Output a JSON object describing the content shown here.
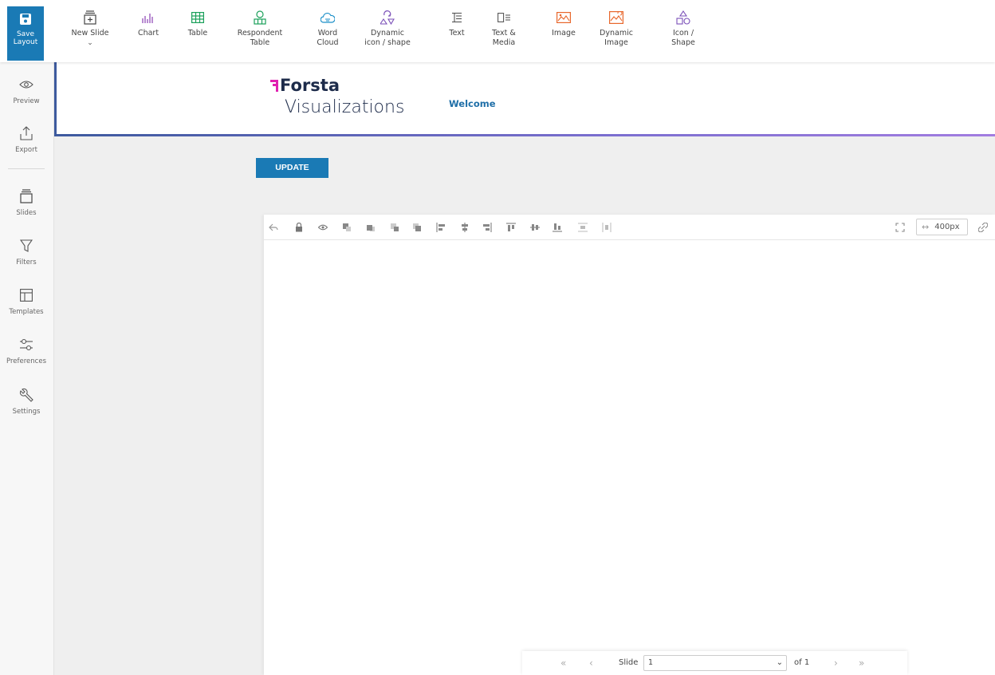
{
  "toolbar": {
    "save": {
      "line1": "Save",
      "line2": "Layout"
    },
    "items": [
      {
        "line1": "New Slide",
        "line2": "",
        "icon": "new-slide-icon",
        "color": "#444444"
      },
      {
        "line1": "Chart",
        "line2": "",
        "icon": "bar-chart-icon",
        "color": "#8a3fb3"
      },
      {
        "line1": "Table",
        "line2": "",
        "icon": "table-icon",
        "color": "#1aa05a"
      },
      {
        "line1": "Respondent",
        "line2": "Table",
        "icon": "respondent-table-icon",
        "color": "#1aa05a"
      },
      {
        "line1": "Word",
        "line2": "Cloud",
        "icon": "word-cloud-icon",
        "color": "#1b8fc8"
      },
      {
        "line1": "Dynamic",
        "line2": "icon / shape",
        "icon": "dynamic-shape-icon",
        "color": "#7a4fb8"
      },
      {
        "line1": "Text",
        "line2": "",
        "icon": "text-icon",
        "color": "#555555"
      },
      {
        "line1": "Text &",
        "line2": "Media",
        "icon": "text-media-icon",
        "color": "#555555"
      },
      {
        "line1": "Image",
        "line2": "",
        "icon": "image-icon",
        "color": "#e8672c"
      },
      {
        "line1": "Dynamic",
        "line2": "Image",
        "icon": "dynamic-image-icon",
        "color": "#e8672c"
      },
      {
        "line1": "Icon /",
        "line2": "Shape",
        "icon": "icon-shape-icon",
        "color": "#7a4fb8"
      }
    ]
  },
  "sidebar": {
    "items": [
      {
        "label": "Preview",
        "icon": "eye-icon"
      },
      {
        "label": "Export",
        "icon": "export-icon"
      },
      {
        "label": "Slides",
        "icon": "slides-icon"
      },
      {
        "label": "Filters",
        "icon": "filter-icon"
      },
      {
        "label": "Templates",
        "icon": "templates-icon"
      },
      {
        "label": "Preferences",
        "icon": "sliders-icon"
      },
      {
        "label": "Settings",
        "icon": "wrench-icon"
      }
    ]
  },
  "header": {
    "logo_brand": "Forsta",
    "logo_product": "Visualizations",
    "welcome": "Welcome",
    "accent": "#1a7ab5",
    "brand_pink": "#e020b0"
  },
  "update_label": "UPDATE",
  "canvas_toolbar": {
    "width_value": "400px"
  },
  "pager": {
    "slide_label": "Slide",
    "slide_value": "1",
    "of_label": "of 1"
  }
}
